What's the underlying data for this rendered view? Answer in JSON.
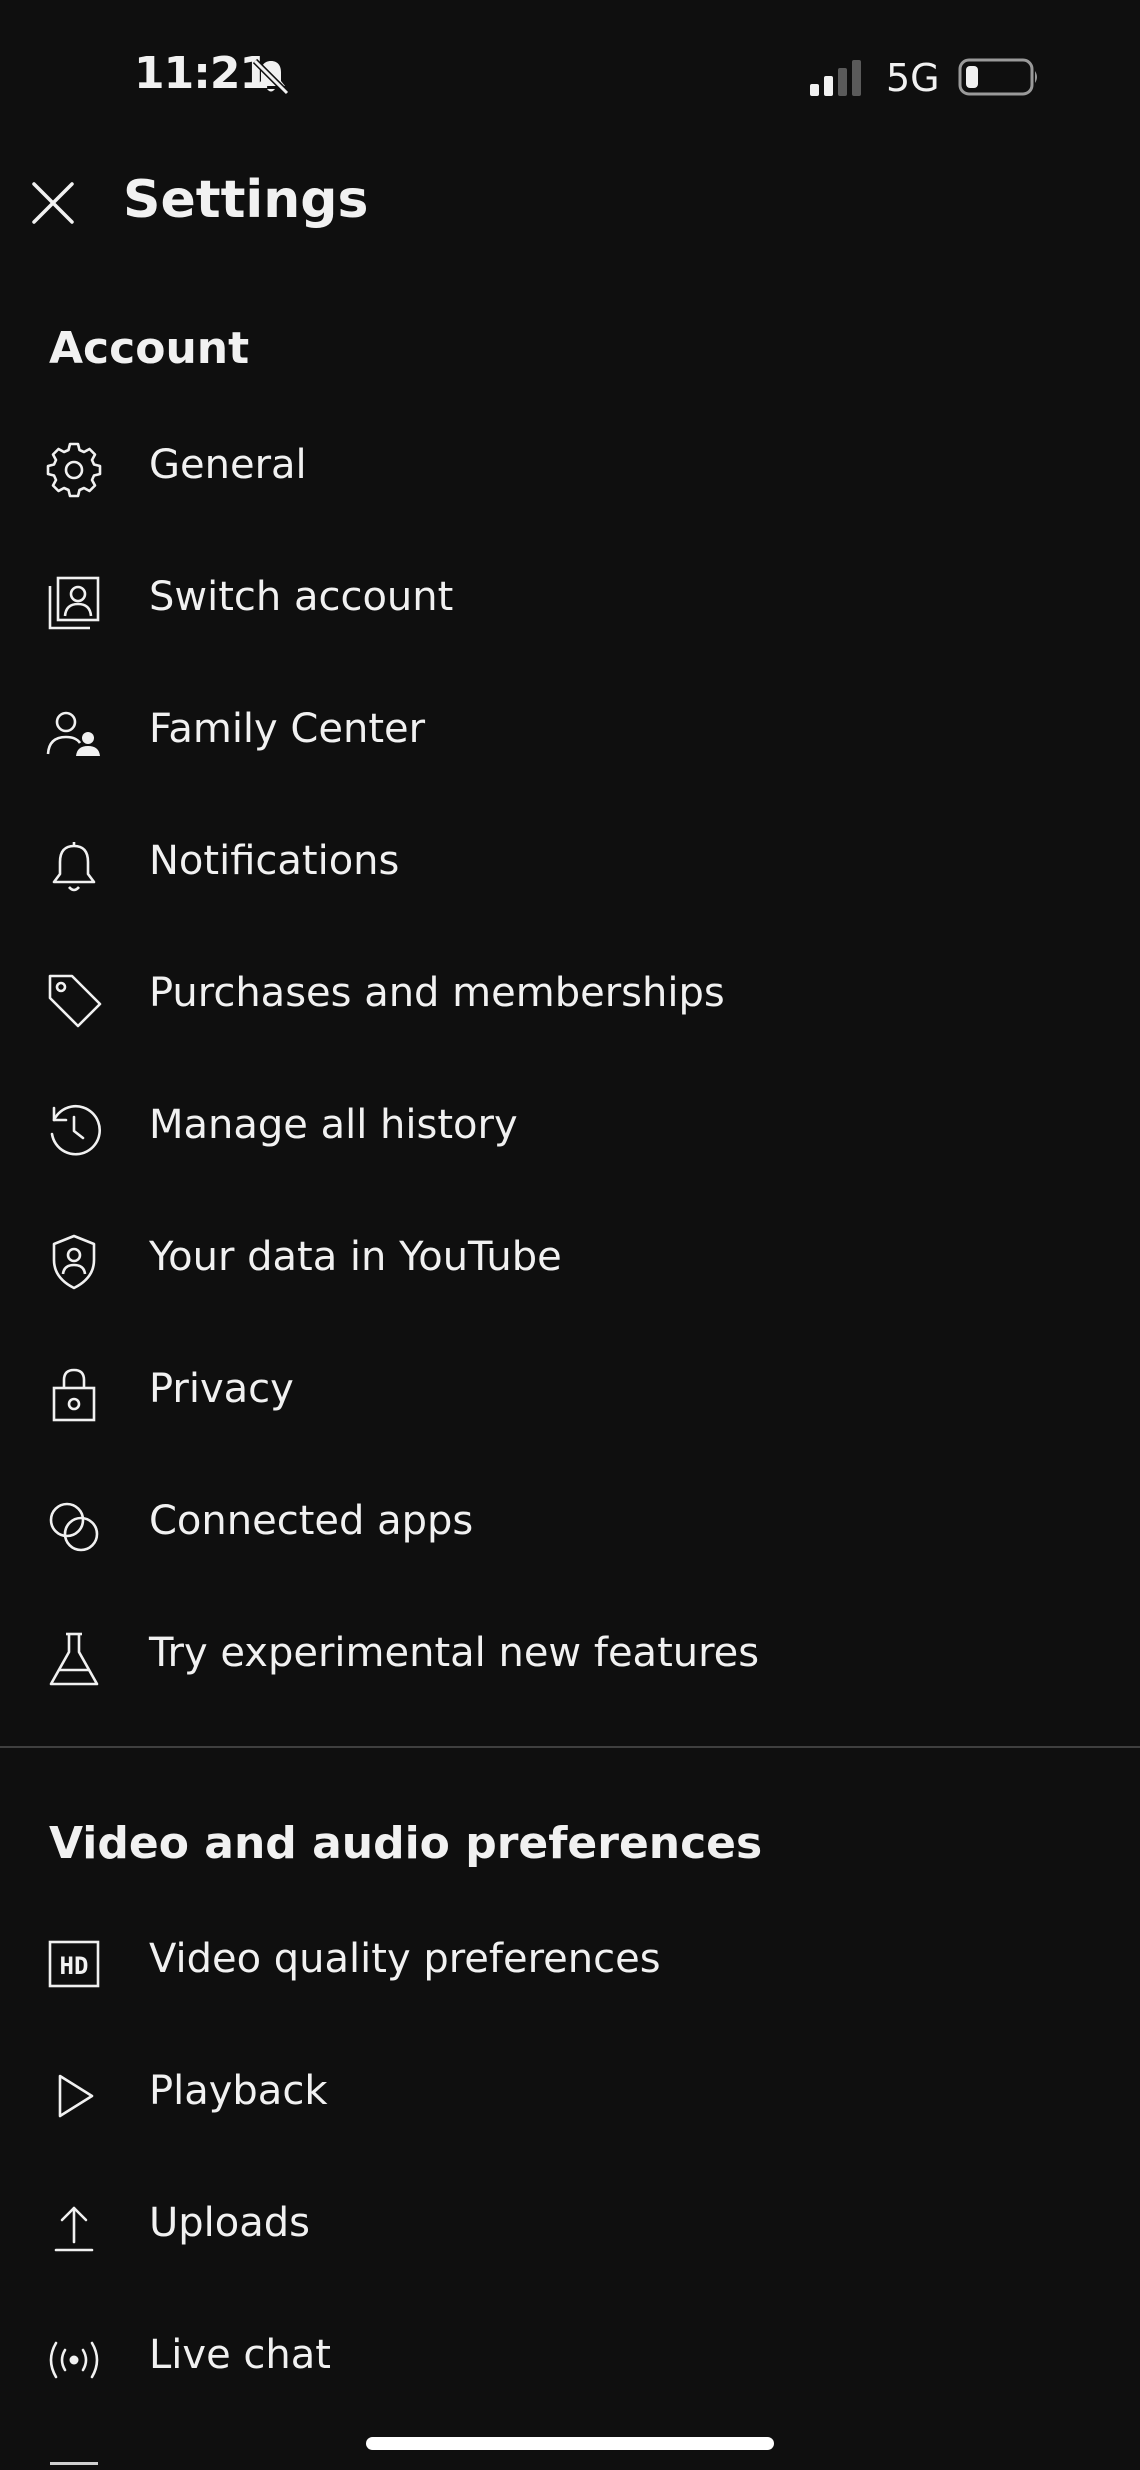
{
  "status_bar": {
    "time": "11:21",
    "network": "5G"
  },
  "header": {
    "title": "Settings"
  },
  "sections": [
    {
      "heading": "Account",
      "items": [
        {
          "label": "General",
          "icon": "gear-icon"
        },
        {
          "label": "Switch account",
          "icon": "switch-account-icon"
        },
        {
          "label": "Family Center",
          "icon": "family-icon"
        },
        {
          "label": "Notifications",
          "icon": "bell-icon"
        },
        {
          "label": "Purchases and memberships",
          "icon": "tag-icon"
        },
        {
          "label": "Manage all history",
          "icon": "history-icon"
        },
        {
          "label": "Your data in YouTube",
          "icon": "shield-person-icon"
        },
        {
          "label": "Privacy",
          "icon": "lock-icon"
        },
        {
          "label": "Connected apps",
          "icon": "connected-apps-icon"
        },
        {
          "label": "Try experimental new features",
          "icon": "flask-icon"
        }
      ]
    },
    {
      "heading": "Video and audio preferences",
      "items": [
        {
          "label": "Video quality preferences",
          "icon": "hd-icon"
        },
        {
          "label": "Playback",
          "icon": "play-icon"
        },
        {
          "label": "Uploads",
          "icon": "upload-icon"
        },
        {
          "label": "Live chat",
          "icon": "live-icon"
        }
      ]
    }
  ],
  "colors": {
    "background": "#0f0f0f",
    "text": "#f1f1f1",
    "divider": "#3f3f3f"
  }
}
